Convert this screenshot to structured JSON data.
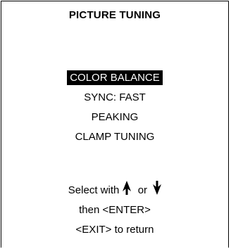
{
  "menu": {
    "title": "PICTURE TUNING",
    "items": [
      {
        "label": "COLOR BALANCE",
        "selected": true
      },
      {
        "label": "SYNC: FAST",
        "selected": false
      },
      {
        "label": "PEAKING",
        "selected": false
      },
      {
        "label": "CLAMP TUNING",
        "selected": false
      }
    ]
  },
  "help": {
    "select_prefix": "Select with",
    "or_word": "or",
    "enter_line": "then <ENTER>",
    "exit_line": "<EXIT> to return",
    "up_icon": "up-arrow-icon",
    "down_icon": "down-arrow-icon"
  },
  "colors": {
    "background": "#ffffff",
    "foreground": "#000000",
    "highlight_bg": "#000000",
    "highlight_fg": "#ffffff"
  }
}
